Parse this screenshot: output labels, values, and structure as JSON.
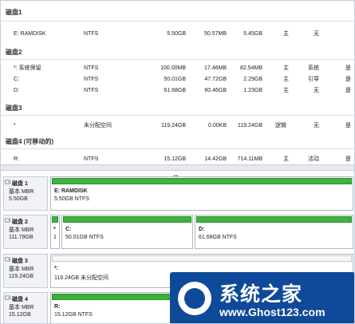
{
  "groups": [
    {
      "title": "磁盘1",
      "rows": [
        [
          "E: RAMDISK",
          "NTFS",
          "5.50GB",
          "50.57MB",
          "5.45GB",
          "主",
          "无",
          ""
        ]
      ]
    },
    {
      "title": "磁盘2",
      "rows": [
        [
          "*: 系统保留",
          "NTFS",
          "100.00MB",
          "17.46MB",
          "82.54MB",
          "主",
          "系统",
          "是"
        ],
        [
          "C:",
          "NTFS",
          "50.01GB",
          "47.72GB",
          "2.29GB",
          "主",
          "引导",
          "是"
        ],
        [
          "D:",
          "NTFS",
          "61.68GB",
          "60.46GB",
          "1.23GB",
          "主",
          "无",
          "是"
        ]
      ]
    },
    {
      "title": "磁盘3",
      "rows": [
        [
          "*",
          "未分配空间",
          "",
          "119.24GB",
          "0.00KB",
          "119.24GB",
          "逻辑",
          "无",
          "是"
        ]
      ]
    },
    {
      "title": "磁盘4 (可移动的)",
      "rows": [
        [
          "R:",
          "NTFS",
          "15.12GB",
          "14.42GB",
          "714.11MB",
          "主",
          "活动",
          "是"
        ]
      ]
    }
  ],
  "disks": [
    {
      "name": "磁盘 1",
      "type": "基本 MBR",
      "size": "5.50GB",
      "parts": [
        {
          "label": "E: RAMDISK",
          "desc": "5.50GB NTFS"
        }
      ]
    },
    {
      "name": "磁盘 2",
      "type": "基本 MBR",
      "size": "111.79GB",
      "parts": [
        {
          "label": "*",
          "desc": "1"
        },
        {
          "label": "C:",
          "desc": "50.01GB NTFS"
        },
        {
          "label": "D:",
          "desc": "61.68GB NTFS"
        }
      ]
    },
    {
      "name": "磁盘 3",
      "type": "基本 MBR",
      "size": "119.24GB",
      "parts": [
        {
          "label": "*:",
          "desc": "119.24GB 未分配空间"
        }
      ]
    },
    {
      "name": "磁盘 4",
      "type": "基本 MBR",
      "size": "15.12GB",
      "parts": [
        {
          "label": "R:",
          "desc": "15.12GB NTFS"
        }
      ]
    }
  ],
  "watermark": {
    "title": "系统之家",
    "url": "www.Ghost123.com"
  }
}
